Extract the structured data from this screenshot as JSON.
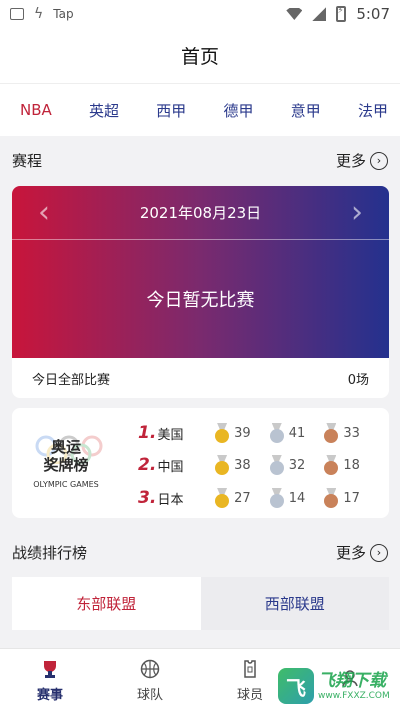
{
  "status_bar": {
    "app_label": "Tap",
    "time": "5:07"
  },
  "header": {
    "title": "首页"
  },
  "leagues": [
    "NBA",
    "英超",
    "西甲",
    "德甲",
    "意甲",
    "法甲"
  ],
  "schedule": {
    "section_title": "赛程",
    "more_label": "更多",
    "date": "2021年08月23日",
    "empty_text": "今日暂无比赛",
    "footer_label": "今日全部比赛",
    "footer_count": "0场"
  },
  "olympic": {
    "logo_title_line1": "奥运",
    "logo_title_line2": "奖牌榜",
    "logo_sub": "OLYMPIC GAMES",
    "rows": [
      {
        "rank": "1.",
        "country": "美国",
        "gold": "39",
        "silver": "41",
        "bronze": "33"
      },
      {
        "rank": "2.",
        "country": "中国",
        "gold": "38",
        "silver": "32",
        "bronze": "18"
      },
      {
        "rank": "3.",
        "country": "日本",
        "gold": "27",
        "silver": "14",
        "bronze": "17"
      }
    ]
  },
  "standings": {
    "section_title": "战绩排行榜",
    "more_label": "更多",
    "tabs": [
      "东部联盟",
      "西部联盟"
    ]
  },
  "bottom_nav": [
    "赛事",
    "球队",
    "球员",
    ""
  ],
  "watermark": {
    "mark": "飞",
    "main": "飞翔下载",
    "url": "www.FXXZ.COM"
  },
  "colors": {
    "accent_red": "#c0243a",
    "accent_blue": "#2b3a8c",
    "gold": "#e9b623",
    "silver": "#b9c3d1",
    "bronze": "#c9825a"
  }
}
